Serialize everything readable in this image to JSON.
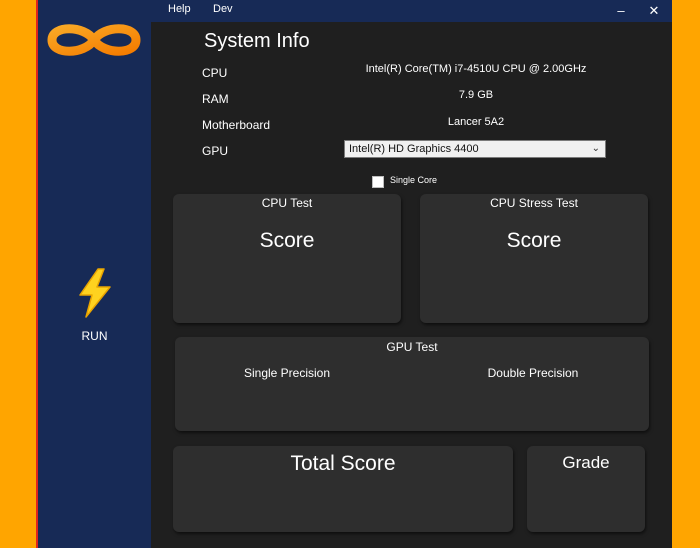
{
  "menu": {
    "help": "Help",
    "dev": "Dev"
  },
  "window_controls": {
    "minimize": "–",
    "close": "✕"
  },
  "sidebar": {
    "run_label": "RUN"
  },
  "system_info": {
    "title": "System Info",
    "cpu_label": "CPU",
    "cpu_value": "Intel(R) Core(TM) i7-4510U CPU @ 2.00GHz",
    "ram_label": "RAM",
    "ram_value": "7.9 GB",
    "motherboard_label": "Motherboard",
    "motherboard_value": "Lancer 5A2",
    "gpu_label": "GPU",
    "gpu_selected": "Intel(R) HD Graphics 4400"
  },
  "single_core": {
    "label": "Single Core",
    "checked": false
  },
  "cpu_test": {
    "title": "CPU Test",
    "score_label": "Score"
  },
  "cpu_stress_test": {
    "title": "CPU Stress Test",
    "score_label": "Score"
  },
  "gpu_test": {
    "title": "GPU Test",
    "single_precision": "Single Precision",
    "double_precision": "Double Precision"
  },
  "total_score": {
    "label": "Total Score"
  },
  "grade": {
    "label": "Grade"
  },
  "colors": {
    "background": "#FFA500",
    "sidebar": "#172A56",
    "window": "#1F1F1F",
    "panel": "#2E2E2E",
    "accent_orange": "#F7941D",
    "lightning": "#FFD21F"
  },
  "icons": {
    "logo": "infinity-logo-icon",
    "run": "lightning-bolt-icon",
    "dropdown": "chevron-down-icon"
  }
}
